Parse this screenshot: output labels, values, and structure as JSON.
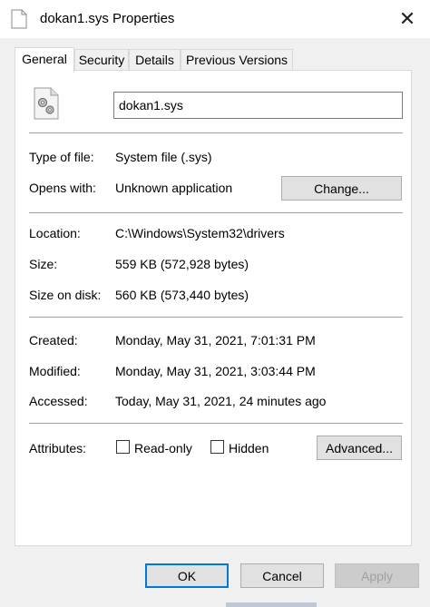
{
  "window": {
    "title": "dokan1.sys Properties",
    "close_glyph": "✕"
  },
  "tabs": [
    {
      "label": "General",
      "active": true
    },
    {
      "label": "Security",
      "active": false
    },
    {
      "label": "Details",
      "active": false
    },
    {
      "label": "Previous Versions",
      "active": false
    }
  ],
  "general": {
    "file_icon": "system-file-gear-icon",
    "file_name": "dokan1.sys",
    "type_label": "Type of file:",
    "type_value": "System file (.sys)",
    "opens_label": "Opens with:",
    "opens_value": "Unknown application",
    "change_button": "Change...",
    "location_label": "Location:",
    "location_value": "C:\\Windows\\System32\\drivers",
    "size_label": "Size:",
    "size_value": "559 KB (572,928 bytes)",
    "size_on_disk_label": "Size on disk:",
    "size_on_disk_value": "560 KB (573,440 bytes)",
    "created_label": "Created:",
    "created_value": "Monday, May 31, 2021, 7:01:31 PM",
    "modified_label": "Modified:",
    "modified_value": "Monday, May 31, 2021, 3:03:44 PM",
    "accessed_label": "Accessed:",
    "accessed_value": "Today, May 31, 2021, 24 minutes ago",
    "attributes_label": "Attributes:",
    "readonly_label": "Read-only",
    "readonly_checked": false,
    "hidden_label": "Hidden",
    "hidden_checked": false,
    "advanced_button": "Advanced..."
  },
  "footer": {
    "ok_label": "OK",
    "cancel_label": "Cancel",
    "apply_label": "Apply"
  },
  "colors": {
    "focus_accent": "#0078d7",
    "dialog_bg": "#f0f0f0"
  }
}
